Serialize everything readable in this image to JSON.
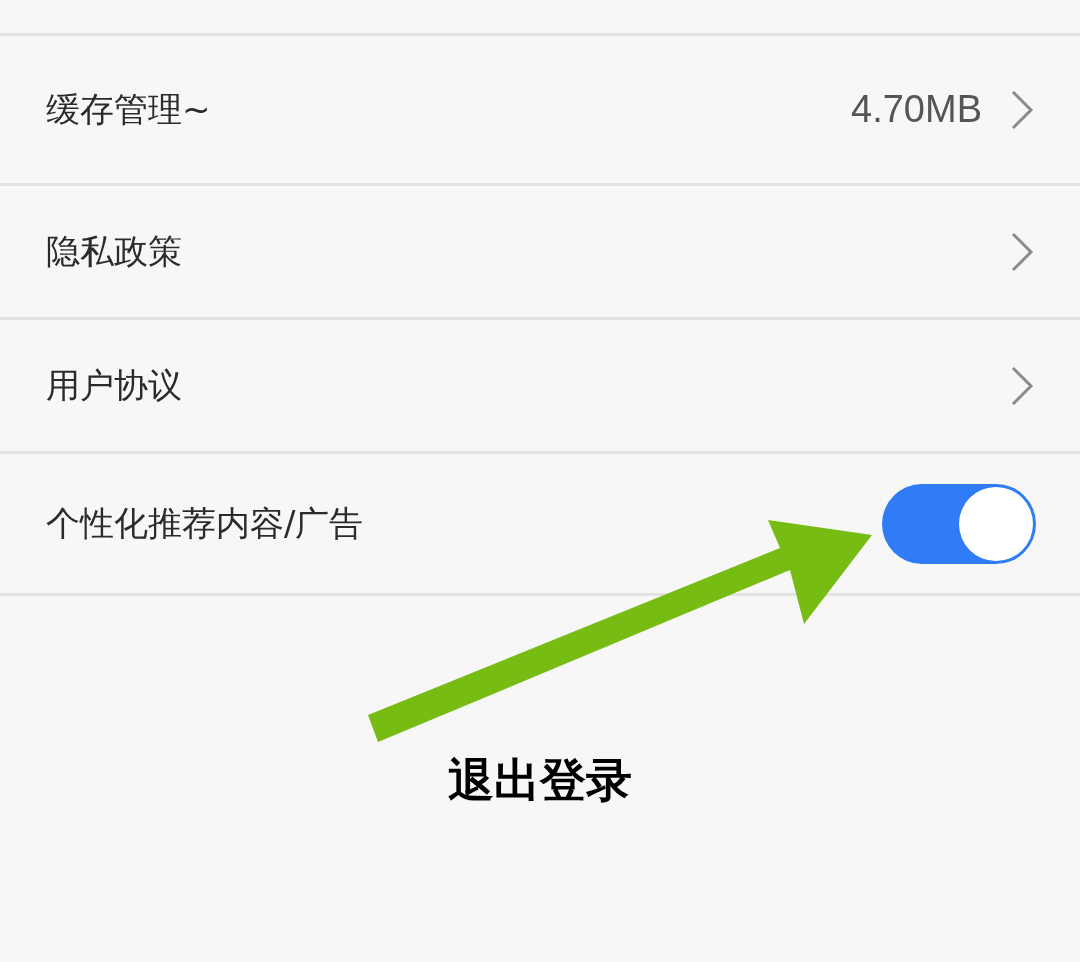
{
  "settings": [
    {
      "kind": "link",
      "label": "缓存管理~",
      "value": "4.70MB"
    },
    {
      "kind": "link",
      "label": "隐私政策"
    },
    {
      "kind": "link",
      "label": "用户协议"
    },
    {
      "kind": "toggle",
      "label": "个性化推荐内容/广告",
      "on": true
    }
  ],
  "logout_button": "退出登录"
}
